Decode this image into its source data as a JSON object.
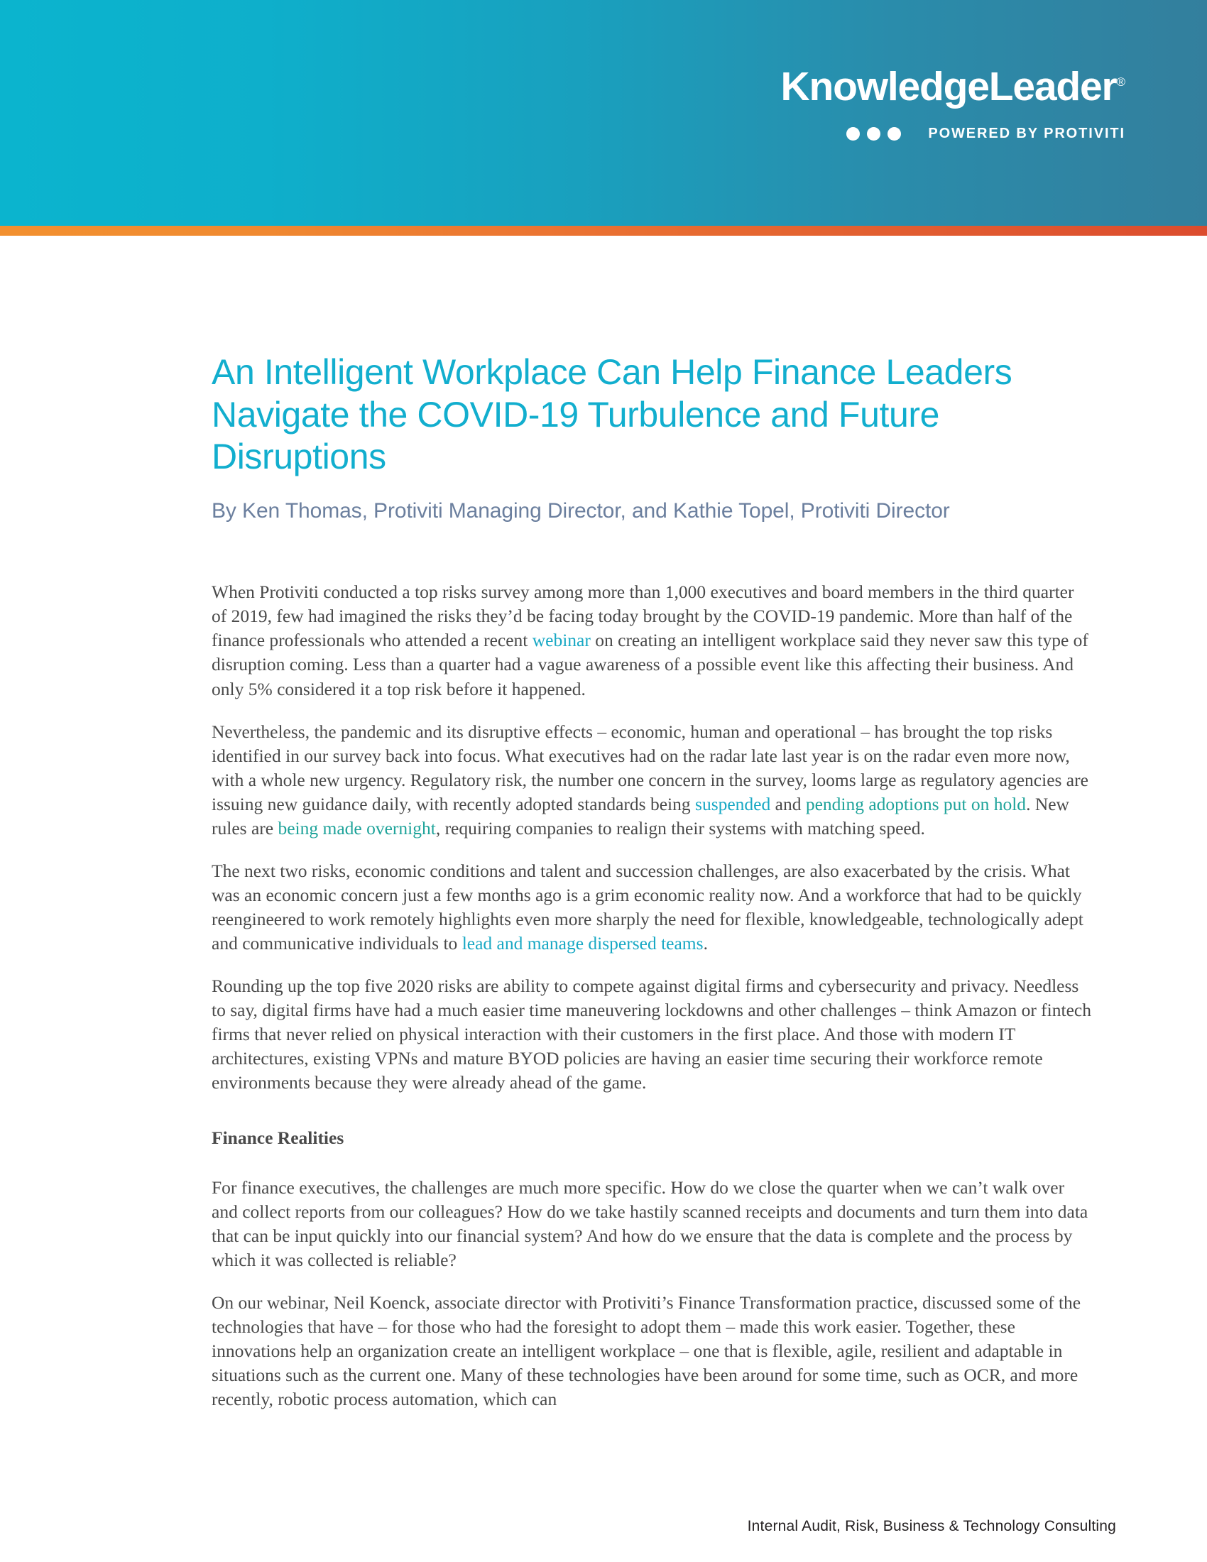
{
  "header": {
    "brand_name": "KnowledgeLeader",
    "brand_registered_mark": "®",
    "tagline": "POWERED BY PROTIVITI",
    "gradient_start": "#0BB4CE",
    "gradient_end": "#337F9D",
    "accent_bar_start": "#F2902F",
    "accent_bar_end": "#DC4C2E",
    "dot_count": 3
  },
  "document": {
    "title": "An Intelligent Workplace Can Help Finance Leaders Navigate the COVID-19 Turbulence and Future Disruptions",
    "title_color": "#12AECE",
    "byline": "By Ken Thomas, Protiviti Managing Director, and Kathie Topel, Protiviti Director",
    "byline_color": "#6B7F9E",
    "body_color": "#4A4A4A",
    "link_color": "#18A8C4"
  },
  "paragraphs": {
    "p1_a": "When Protiviti conducted a top risks survey among more than 1,000 executives and board members in the third quarter of 2019, few had imagined the risks they’d be facing today brought by the COVID-19 pandemic. More than half of the finance professionals who attended a recent ",
    "p1_link": "webinar",
    "p1_b": " on creating an intelligent workplace said they never saw this type of disruption coming. Less than a quarter had a vague awareness of a possible event like this affecting their business. And only 5% considered it a top risk before it happened.",
    "p2_a": "Nevertheless, the pandemic and its disruptive effects – economic, human and operational – has brought the top risks identified in our survey back into focus. What executives had on the radar late last year is on the radar even more now, with a whole new urgency. Regulatory risk, the number one concern in the survey, looms large as regulatory agencies are issuing new guidance daily, with recently adopted standards being ",
    "p2_link1": "suspended",
    "p2_b": " and ",
    "p2_link2": "pending adoptions put on hold",
    "p2_c": ". New rules are ",
    "p2_link3": "being made overnight",
    "p2_d": ", requiring companies to realign their systems with matching speed.",
    "p3_a": "The next two risks, economic conditions and talent and succession challenges, are also exacerbated by the crisis. What was an economic concern just a few months ago is a grim economic reality now. And a workforce that had to be quickly reengineered to work remotely highlights even more sharply the need for flexible, knowledgeable, technologically adept and communicative individuals to ",
    "p3_link": "lead and manage dispersed teams",
    "p3_b": ".",
    "p4": "Rounding up the top five 2020 risks are ability to compete against digital firms and cybersecurity and privacy. Needless to say, digital firms have had a much easier time maneuvering lockdowns and other challenges – think Amazon or fintech firms that never relied on physical interaction with their customers in the first place. And those with modern IT architectures, existing VPNs and mature BYOD policies are having an easier time securing their workforce remote environments because they were already ahead of the game.",
    "section_heading": "Finance Realities",
    "p5": "For finance executives, the challenges are much more specific. How do we close the quarter when we can’t walk over and collect reports from our colleagues? How do we take hastily scanned receipts and documents and turn them into data that can be input quickly into our financial system? And how do we ensure that the data is complete and the process by which it was collected is reliable?",
    "p6": "On our webinar, Neil Koenck, associate director with Protiviti’s Finance Transformation practice, discussed some of the technologies that have – for those who had the foresight to adopt them – made this work easier. Together, these innovations help an organization create an intelligent workplace – one that is flexible, agile, resilient and adaptable in situations such as the current one. Many of these technologies have been around for some time, such as OCR, and more recently, robotic process automation, which can"
  },
  "footer": {
    "text": "Internal Audit, Risk, Business & Technology Consulting"
  }
}
